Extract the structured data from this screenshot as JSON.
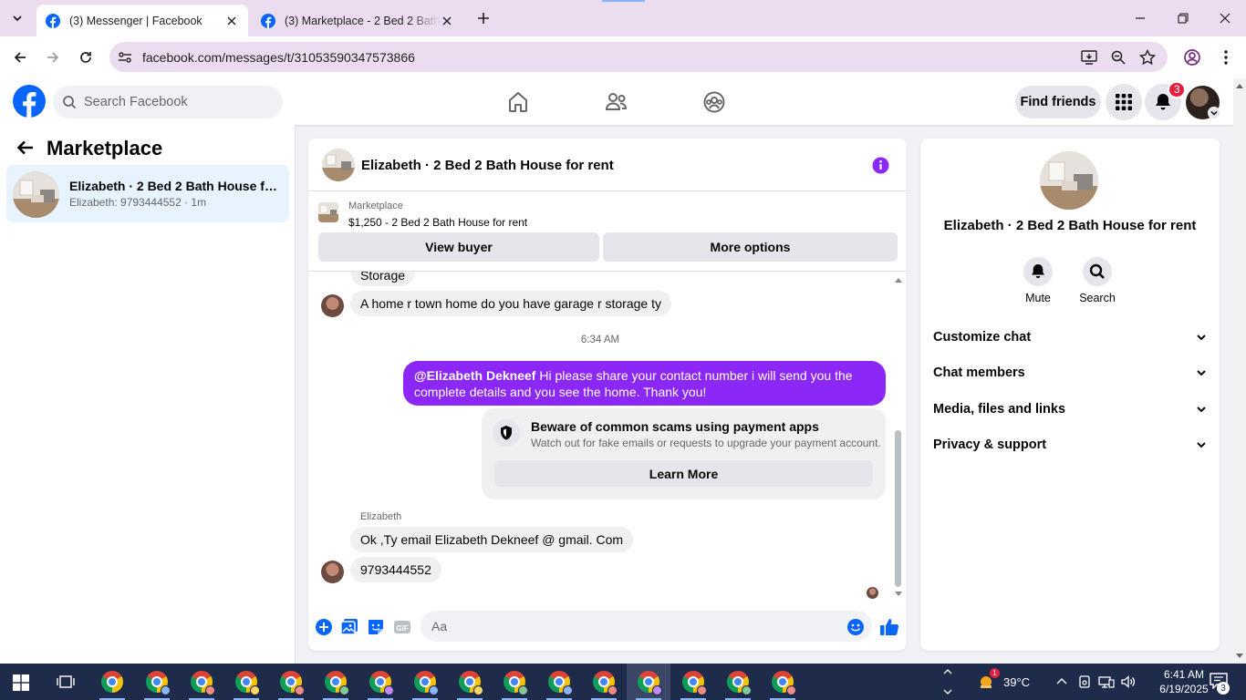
{
  "browser": {
    "tabs": [
      {
        "title": "(3) Messenger | Facebook",
        "active": true
      },
      {
        "title": "(3) Marketplace - 2 Bed 2 Bath",
        "active": false
      }
    ],
    "url": "facebook.com/messages/t/31053590347573866"
  },
  "fb_header": {
    "search_placeholder": "Search Facebook",
    "find_friends_label": "Find friends",
    "notification_count": "3"
  },
  "sidebar": {
    "title": "Marketplace",
    "conversation": {
      "name": "Elizabeth · 2 Bed 2 Bath House for rent",
      "preview": "Elizabeth: 9793444552 · 1m"
    }
  },
  "chat": {
    "title": "Elizabeth · 2 Bed 2 Bath House for rent",
    "listing": {
      "source": "Marketplace",
      "price_title": "$1,250 - 2 Bed 2 Bath House for rent"
    },
    "buttons": {
      "view_buyer": "View buyer",
      "more_options": "More options"
    },
    "messages": {
      "cutoff_text": "Storage",
      "incoming_1": "A home r town home do you have garage r storage ty",
      "timestamp": "6:34 AM",
      "outgoing_mention": "@Elizabeth Dekneef",
      "outgoing_text": " Hi please share your contact number i will send you the complete details and you see the home. Thank you!",
      "sender_name": "Elizabeth",
      "incoming_2": "Ok ,Ty email Elizabeth Dekneef @ gmail. Com",
      "incoming_3": "9793444552"
    },
    "scam_card": {
      "title": "Beware of common scams using payment apps",
      "description": "Watch out for fake emails or requests to upgrade your payment account.",
      "button": "Learn More"
    },
    "composer_placeholder": "Aa"
  },
  "info_panel": {
    "title": "Elizabeth · 2 Bed 2 Bath House for rent",
    "actions": {
      "mute": "Mute",
      "search": "Search"
    },
    "sections": [
      "Customize chat",
      "Chat members",
      "Media, files and links",
      "Privacy & support"
    ]
  },
  "taskbar": {
    "weather": "39°C",
    "weather_badge": "1",
    "time": "6:41 AM",
    "date": "6/19/2025",
    "notification_count": "3"
  },
  "colors": {
    "fb_blue": "#0866ff",
    "messenger_purple": "#8c28f7",
    "selected_bg": "#e7f3ff",
    "taskbar": "#1e2b4a"
  }
}
